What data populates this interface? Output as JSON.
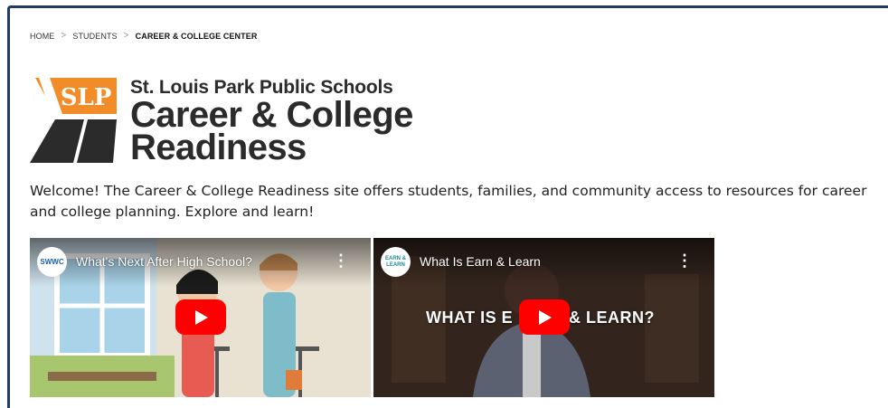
{
  "breadcrumb": {
    "home": "HOME",
    "students": "STUDENTS",
    "current": "CAREER & COLLEGE CENTER"
  },
  "brand": {
    "district": "St. Louis Park Public Schools",
    "program_line1": "Career & College",
    "program_line2": "Readiness",
    "logo_orange": "#f28c28",
    "logo_dark": "#2b2b2b"
  },
  "intro": {
    "text": "Welcome! The Career & College Readiness site offers students, families, and community access to resources for career and college planning. Explore and learn!"
  },
  "videos": [
    {
      "title": "What's Next After High School?",
      "channel_badge": "SWWC",
      "menu_icon": "more-vert-icon",
      "play_icon": "youtube-play-icon"
    },
    {
      "title": "What Is Earn & Learn",
      "channel_badge": "EARN & LEARN",
      "overlay_left": "WHAT IS E",
      "overlay_right": "& LEARN?",
      "menu_icon": "more-vert-icon",
      "play_icon": "youtube-play-icon"
    }
  ],
  "colors": {
    "frame_border": "#1f3b66",
    "youtube_red": "#ff0000"
  }
}
